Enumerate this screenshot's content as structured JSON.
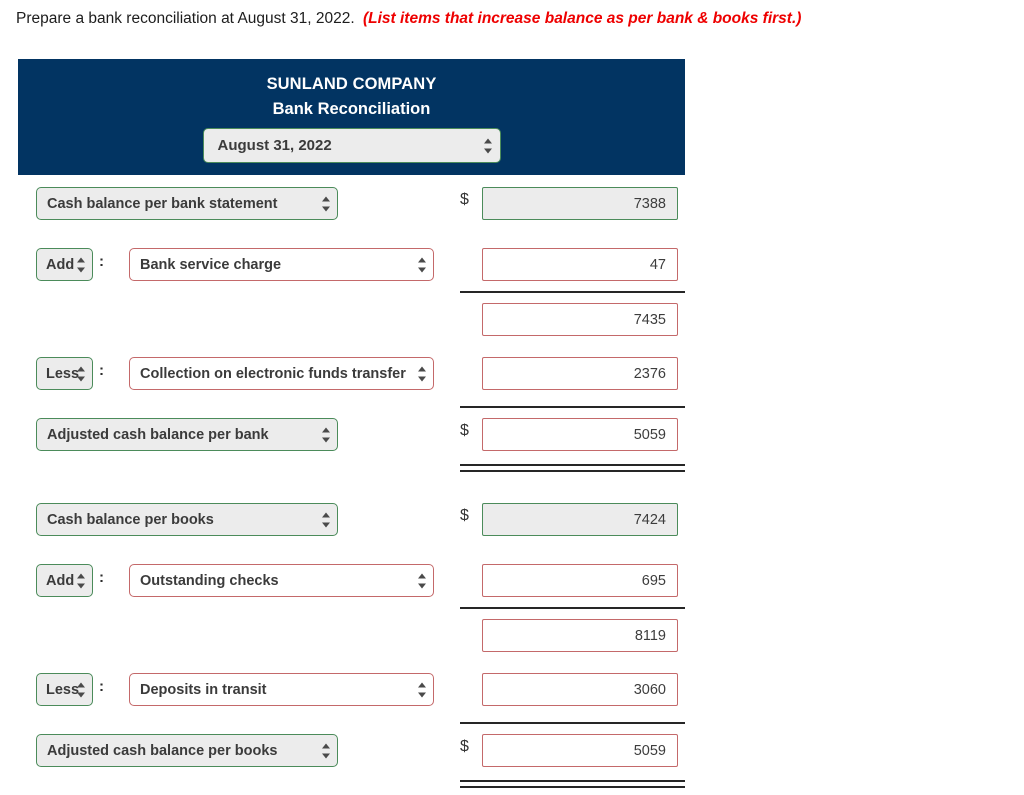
{
  "prompt": {
    "question": "Prepare a bank reconciliation at August 31, 2022.",
    "hint": "(List items that increase balance as per bank & books first.)"
  },
  "colors": {
    "header_navy": "#023462",
    "valid_green": "#4b8b5a",
    "invalid_red": "#c4696a",
    "hint_red": "#ee0000",
    "locked_gray": "#ececec"
  },
  "header": {
    "company": "SUNLAND COMPANY",
    "subtitle": "Bank Reconciliation",
    "date_select": {
      "value": "August 31, 2022",
      "state": "valid"
    }
  },
  "bank_section": {
    "rows": [
      {
        "type": "label-amount",
        "label": "Cash balance per bank statement",
        "label_state": "valid",
        "dollar": "$",
        "amount": "7388",
        "amount_state": "locked"
      },
      {
        "type": "addless-item-amount",
        "addless": "Add",
        "addless_state": "valid",
        "separator": ":",
        "item": "Bank service charge",
        "item_state": "invalid",
        "dollar": "",
        "amount": "47",
        "amount_state": "invalid"
      },
      {
        "type": "subtotal",
        "rule": "single",
        "dollar": "",
        "amount": "7435",
        "amount_state": "invalid"
      },
      {
        "type": "addless-item-amount",
        "addless": "Less",
        "addless_state": "valid",
        "separator": ":",
        "item": "Collection on electronic funds transfer",
        "item_state": "invalid",
        "dollar": "",
        "amount": "2376",
        "amount_state": "invalid"
      },
      {
        "type": "total",
        "rule": "single",
        "label": "Adjusted cash balance per bank",
        "label_state": "valid",
        "dollar": "$",
        "amount": "5059",
        "amount_state": "invalid",
        "closing_rule": "double"
      }
    ]
  },
  "books_section": {
    "rows": [
      {
        "type": "label-amount",
        "label": "Cash balance per books",
        "label_state": "valid",
        "dollar": "$",
        "amount": "7424",
        "amount_state": "locked"
      },
      {
        "type": "addless-item-amount",
        "addless": "Add",
        "addless_state": "valid",
        "separator": ":",
        "item": "Outstanding checks",
        "item_state": "invalid",
        "dollar": "",
        "amount": "695",
        "amount_state": "invalid"
      },
      {
        "type": "subtotal",
        "rule": "single",
        "dollar": "",
        "amount": "8119",
        "amount_state": "invalid"
      },
      {
        "type": "addless-item-amount",
        "addless": "Less",
        "addless_state": "valid",
        "separator": ":",
        "item": "Deposits in transit",
        "item_state": "invalid",
        "dollar": "",
        "amount": "3060",
        "amount_state": "invalid"
      },
      {
        "type": "total",
        "rule": "single",
        "label": "Adjusted cash balance per books",
        "label_state": "valid",
        "dollar": "$",
        "amount": "5059",
        "amount_state": "invalid",
        "closing_rule": "double"
      }
    ]
  }
}
